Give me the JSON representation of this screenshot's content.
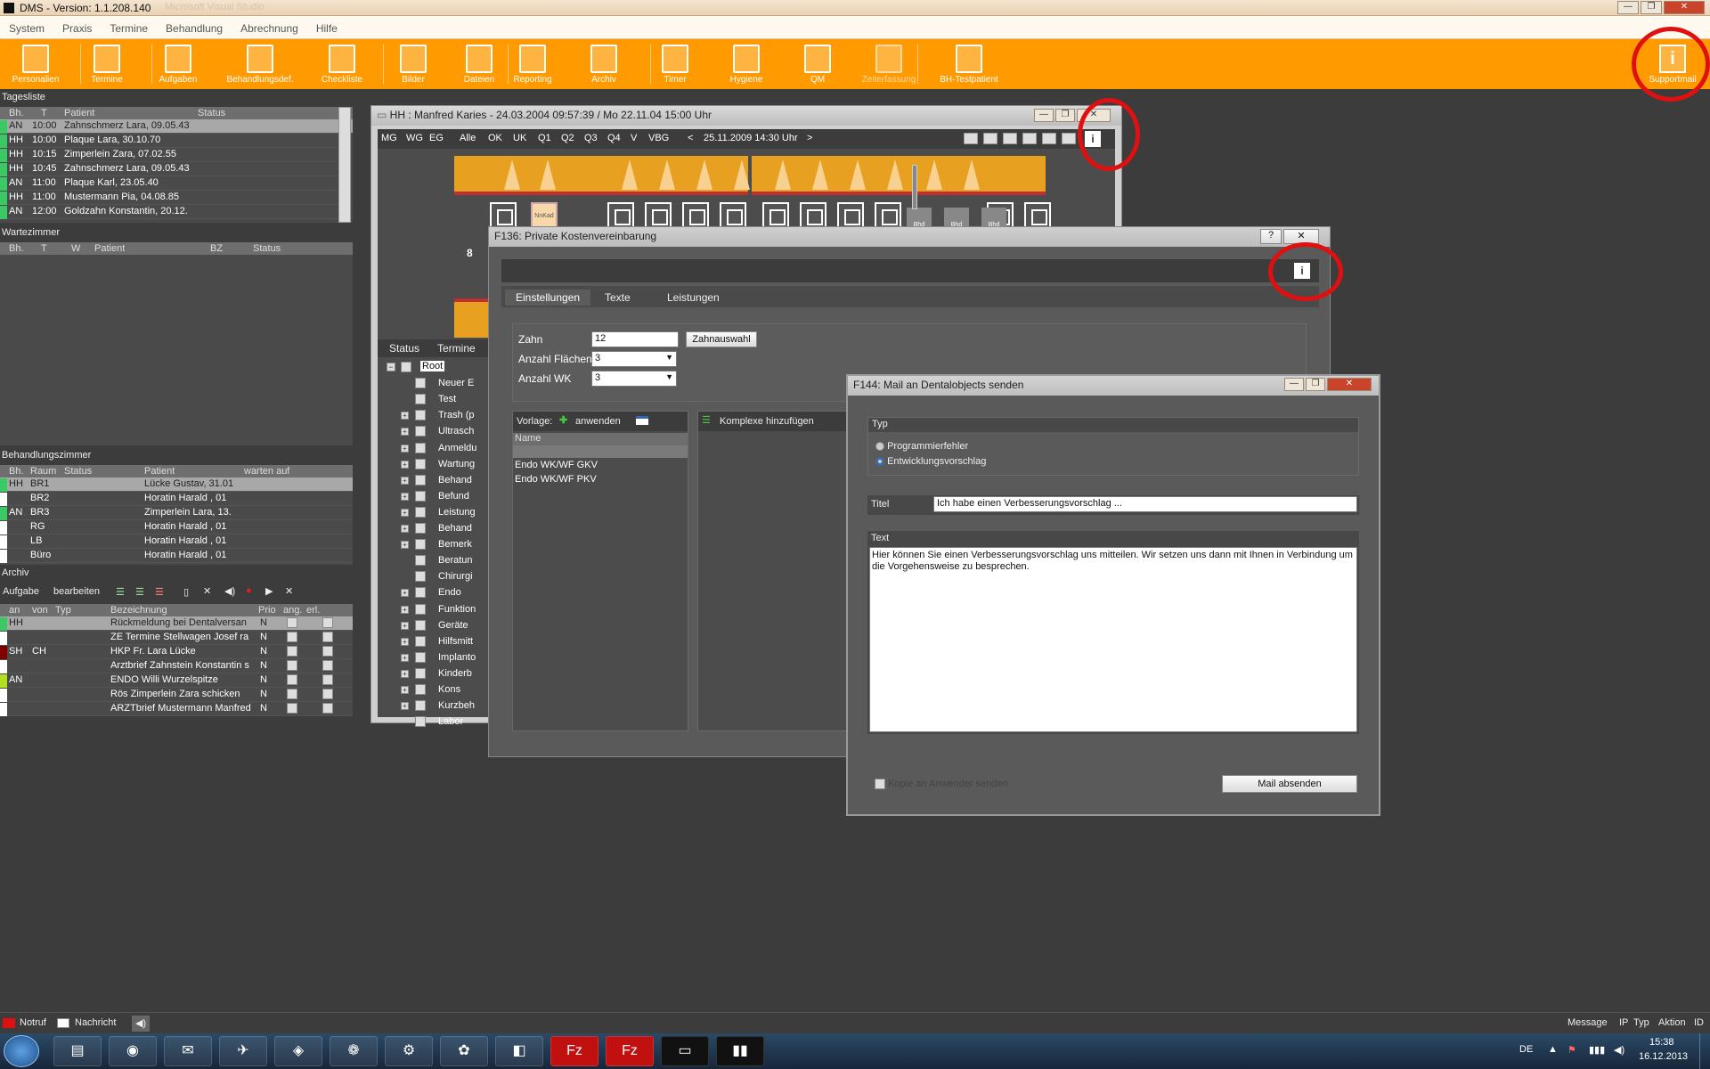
{
  "app": {
    "title": "DMS - Version: 1.1.208.140",
    "subtitle": "Microsoft Visual Studio"
  },
  "menu": [
    "System",
    "Praxis",
    "Termine",
    "Behandlung",
    "Abrechnung",
    "Hilfe"
  ],
  "toolbar": [
    {
      "label": "Personalien",
      "icon": "person-icon"
    },
    {
      "label": "Termine",
      "icon": "calendar-icon"
    },
    {
      "label": "Aufgaben",
      "icon": "task-icon"
    },
    {
      "label": "Behandlungsdef.",
      "icon": "treatment-def-icon"
    },
    {
      "label": "Checkliste",
      "icon": "checklist-icon"
    },
    {
      "label": "Bilder",
      "icon": "image-icon"
    },
    {
      "label": "Dateien",
      "icon": "file-icon"
    },
    {
      "label": "Reporting",
      "icon": "chart-icon"
    },
    {
      "label": "Archiv",
      "icon": "archive-icon"
    },
    {
      "label": "Timer",
      "icon": "timer-icon"
    },
    {
      "label": "Hygiene",
      "icon": "barcode-icon"
    },
    {
      "label": "QM",
      "icon": "qm-icon"
    },
    {
      "label": "Zeiterfassung",
      "icon": "time-tracking-icon"
    },
    {
      "label": "BH-Testpatient",
      "icon": "test-patient-icon"
    }
  ],
  "support": {
    "label": "Supportmail",
    "icon": "info-icon"
  },
  "tagesliste": {
    "title": "Tagesliste",
    "cols": [
      "Bh.",
      "T",
      "Patient",
      "Status"
    ],
    "rows": [
      {
        "bh": "AN",
        "t": "10:00",
        "patient": "Zahnschmerz Lara, 09.05.43",
        "color": "#3cc864"
      },
      {
        "bh": "HH",
        "t": "10:00",
        "patient": "Plaque Lara, 30.10.70",
        "color": "#3cc864"
      },
      {
        "bh": "HH",
        "t": "10:15",
        "patient": "Zimperlein Zara, 07.02.55",
        "color": "#3cc864"
      },
      {
        "bh": "HH",
        "t": "10:45",
        "patient": "Zahnschmerz Lara, 09.05.43",
        "color": "#3cc864"
      },
      {
        "bh": "AN",
        "t": "11:00",
        "patient": "Plaque Karl, 23.05.40",
        "color": "#3cc864"
      },
      {
        "bh": "HH",
        "t": "11:00",
        "patient": "Mustermann Pia, 04.08.85",
        "color": "#3cc864"
      },
      {
        "bh": "AN",
        "t": "12:00",
        "patient": "Goldzahn Konstantin, 20.12.",
        "color": "#3cc864"
      }
    ]
  },
  "wartezimmer": {
    "title": "Wartezimmer",
    "cols": [
      "Bh.",
      "T",
      "W",
      "Patient",
      "BZ",
      "Status"
    ]
  },
  "behandlungszimmer": {
    "title": "Behandlungszimmer",
    "cols": [
      "Bh.",
      "Raum",
      "Status",
      "Patient",
      "warten auf"
    ],
    "rows": [
      {
        "bh": "HH",
        "raum": "BR1",
        "patient": "Lücke Gustav, 31.01",
        "color": "#3cc864"
      },
      {
        "bh": "",
        "raum": "BR2",
        "patient": "Horatin Harald , 01",
        "color": "#ffffff"
      },
      {
        "bh": "AN",
        "raum": "BR3",
        "patient": "Zimperlein Lara, 13.",
        "color": "#3cc864"
      },
      {
        "bh": "",
        "raum": "RG",
        "patient": "Horatin Harald , 01",
        "color": "#ffffff"
      },
      {
        "bh": "",
        "raum": "LB",
        "patient": "Horatin Harald , 01",
        "color": "#ffffff"
      },
      {
        "bh": "",
        "raum": "Büro",
        "patient": "Horatin Harald , 01",
        "color": "#ffffff"
      }
    ]
  },
  "archiv": {
    "title": "Archiv",
    "tabs": [
      "Aufgabe",
      "bearbeiten"
    ],
    "cols": [
      "an",
      "von",
      "Typ",
      "Bezeichnung",
      "Prio",
      "ang.",
      "erl."
    ],
    "rows": [
      {
        "an": "HH",
        "von": "",
        "bez": "Rückmeldung bei Dentalversan",
        "prio": "N",
        "color": "#3cc864"
      },
      {
        "an": "",
        "von": "",
        "bez": "ZE Termine Stellwagen Josef ra",
        "prio": "N",
        "color": "#ffffff"
      },
      {
        "an": "SH",
        "von": "CH",
        "bez": "HKP Fr. Lara Lücke",
        "prio": "N",
        "color": "#800000"
      },
      {
        "an": "",
        "von": "",
        "bez": "Arztbrief Zahnstein Konstantin s",
        "prio": "N",
        "color": "#ffffff"
      },
      {
        "an": "AN",
        "von": "",
        "bez": "ENDO Willi Wurzelspitze",
        "prio": "N",
        "color": "#b0e020"
      },
      {
        "an": "",
        "von": "",
        "bez": "Rös Zimperlein Zara schicken",
        "prio": "N",
        "color": "#ffffff"
      },
      {
        "an": "",
        "von": "",
        "bez": "ARZTbrief Mustermann Manfred",
        "prio": "N",
        "color": "#ffffff"
      }
    ]
  },
  "patientwin": {
    "title": "HH : Manfred Karies - 24.03.2004 09:57:39 / Mo 22.11.04 15:00 Uhr",
    "filters": [
      "MG",
      "WG",
      "EG",
      "Alle",
      "OK",
      "UK",
      "Q1",
      "Q2",
      "Q3",
      "Q4",
      "V",
      "VBG"
    ],
    "date": "25.11.2009 14:30 Uhr",
    "quadrant": "8",
    "tabs": [
      "Status",
      "Termine"
    ],
    "tree": [
      "Root",
      "Neuer E",
      "Test",
      "Trash (p",
      "Ultrasch",
      "Anmeldu",
      "Wartung",
      "Behand",
      "Befund",
      "Leistung",
      "Behand",
      "Bemerk",
      "Beratun",
      "Chirurgi",
      "Endo",
      "Funktion",
      "Geräte",
      "Hilfsmitt",
      "Implanto",
      "Kinderb",
      "Kons",
      "Kurzbeh",
      "Labor"
    ],
    "tooth_labels": [
      "NnKad",
      "Bhd",
      "Bhd",
      "Bhd"
    ]
  },
  "f136": {
    "title": "F136: Private Kostenvereinbarung",
    "tabs": [
      "Einstellungen",
      "Texte",
      "Leistungen"
    ],
    "zahn_label": "Zahn",
    "zahn_value": "12",
    "zahnauswahl": "Zahnauswahl",
    "flaechen_label": "Anzahl Flächen",
    "flaechen_value": "3",
    "wk_label": "Anzahl WK",
    "wk_value": "3",
    "vorlage": "Vorlage:",
    "anwenden": "anwenden",
    "komplexe": "Komplexe hinzufügen",
    "name_col": "Name",
    "items": [
      "Endo WK/WF GKV",
      "Endo WK/WF PKV"
    ],
    "help": "?",
    "close": "✕"
  },
  "f144": {
    "title": "F144: Mail an Dentalobjects senden",
    "typ_label": "Typ",
    "options": [
      "Programmierfehler",
      "Entwicklungsvorschlag"
    ],
    "selected": 1,
    "titel_label": "Titel",
    "titel_value": "Ich habe einen Verbesserungsvorschlag ...",
    "text_label": "Text",
    "text_value": "Hier können Sie einen Verbesserungsvorschlag uns mitteilen. Wir setzen uns dann mit Ihnen in Verbindung um die Vorgehensweise zu besprechen.",
    "kopie": "Kopie an Anwender senden",
    "send": "Mail absenden"
  },
  "status": {
    "notruf": "Notruf",
    "nachricht": "Nachricht",
    "right": [
      "Message",
      "IP",
      "Typ",
      "Aktion",
      "ID"
    ]
  },
  "taskbar": {
    "lang": "DE",
    "time": "15:38",
    "date": "16.12.2013"
  }
}
